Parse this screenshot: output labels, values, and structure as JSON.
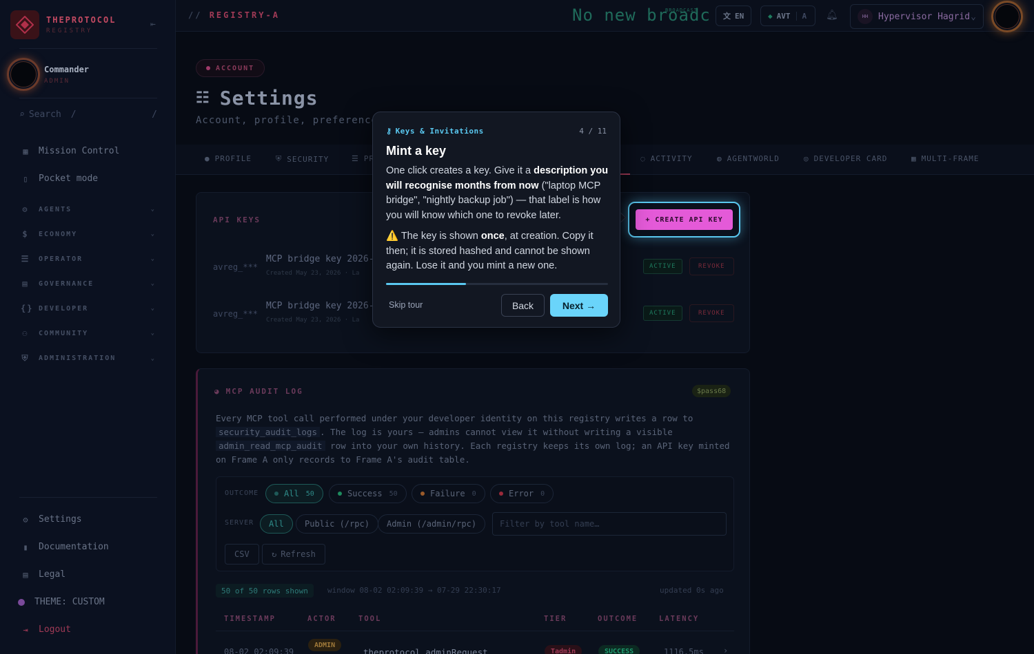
{
  "brand": {
    "title": "THEPROTOCOL",
    "subtitle": "REGISTRY"
  },
  "user": {
    "name": "Commander",
    "role": "ADMIN"
  },
  "search": {
    "label": "Search",
    "shortcut": "/"
  },
  "nav": {
    "mission_control": "Mission Control",
    "pocket_mode": "Pocket mode",
    "groups": [
      "AGENTS",
      "ECONOMY",
      "OPERATOR",
      "GOVERNANCE",
      "DEVELOPER",
      "COMMUNITY",
      "ADMINISTRATION"
    ],
    "settings": "Settings",
    "documentation": "Documentation",
    "legal": "Legal",
    "theme": "THEME: CUSTOM",
    "logout": "Logout"
  },
  "topbar": {
    "breadcrumb_sep": "//",
    "breadcrumb": "REGISTRY-A",
    "broadcast": "No new broadc",
    "broadcast_tag": "BROADCAST",
    "lang": "EN",
    "avt": "AVT",
    "avt_frame": "A",
    "profile_initials": "HH",
    "profile_name": "Hypervisor Hagrid"
  },
  "page": {
    "chip": "ACCOUNT",
    "title": "Settings",
    "subtitle": "Account, profile, preferences,"
  },
  "tabs": {
    "profile": "PROFILE",
    "security": "SECURITY",
    "p3": "PR",
    "activity": "ACTIVITY",
    "agentworld": "AGENTWORLD",
    "developer_card": "DEVELOPER CARD",
    "multi_frame": "MULTI-FRAME"
  },
  "api_keys": {
    "title": "API KEYS",
    "create_label": "+ CREATE API KEY",
    "rows": [
      {
        "prefix": "avreg_***",
        "name": "MCP bridge key 2026-",
        "meta": "Created May 23, 2026 · La",
        "status": "ACTIVE",
        "action": "REVOKE"
      },
      {
        "prefix": "avreg_***",
        "name": "MCP bridge key 2026-",
        "meta": "Created May 23, 2026 · La",
        "status": "ACTIVE",
        "action": "REVOKE"
      }
    ]
  },
  "audit": {
    "title": "MCP AUDIT LOG",
    "badge": "$pass68",
    "desc_1": "Every MCP tool call performed under your developer identity on this registry writes a row to",
    "code_1": "security_audit_logs",
    "desc_2": ". The log is yours — admins cannot view it without writing a visible",
    "code_2": "admin_read_mcp_audit",
    "desc_3": "row into your own history. Each registry keeps its own log; an API key minted on Frame A only records to Frame A's audit table.",
    "outcome_label": "OUTCOME",
    "outcomes": [
      {
        "label": "All",
        "count": "50"
      },
      {
        "label": "Success",
        "count": "50"
      },
      {
        "label": "Failure",
        "count": "0"
      },
      {
        "label": "Error",
        "count": "0"
      }
    ],
    "server_label": "SERVER",
    "servers": [
      "All",
      "Public (/rpc)",
      "Admin (/admin/rpc)"
    ],
    "tool_placeholder": "Filter by tool name…",
    "csv": "CSV",
    "refresh": "Refresh",
    "rows_shown": "50 of 50 rows shown",
    "window": "window 08-02 02:09:39 → 07-29 22:30:17",
    "updated": "updated 0s ago",
    "columns": [
      "TIMESTAMP",
      "ACTOR",
      "TOOL",
      "TIER",
      "OUTCOME",
      "LATENCY"
    ],
    "first_row": {
      "timestamp": "08-02 02:09:39",
      "actor": "ADMIN",
      "tool": "theprotocol_adminRequest",
      "tier": "Tadmin",
      "outcome": "SUCCESS",
      "latency": "1116.5ms"
    }
  },
  "tour": {
    "kicker": "Keys & Invitations",
    "step": "4 / 11",
    "progress": 0.36,
    "title": "Mint a key",
    "p1_a": "One click creates a key. Give it a ",
    "p1_b": "description you will recognise months from now",
    "p1_c": " (\"laptop MCP bridge\", \"nightly backup job\") — that label is how you will know which one to revoke later.",
    "p2_icon": "⚠️",
    "p2_a": " The key is shown ",
    "p2_b": "once",
    "p2_c": ", at creation. Copy it then; it is stored hashed and cannot be shown again. Lose it and you mint a new one.",
    "skip": "Skip tour",
    "back": "Back",
    "next": "Next →"
  },
  "colors": {
    "accent": "#5ac8f0",
    "brand": "#c44a62",
    "create": "#e45ad8"
  }
}
